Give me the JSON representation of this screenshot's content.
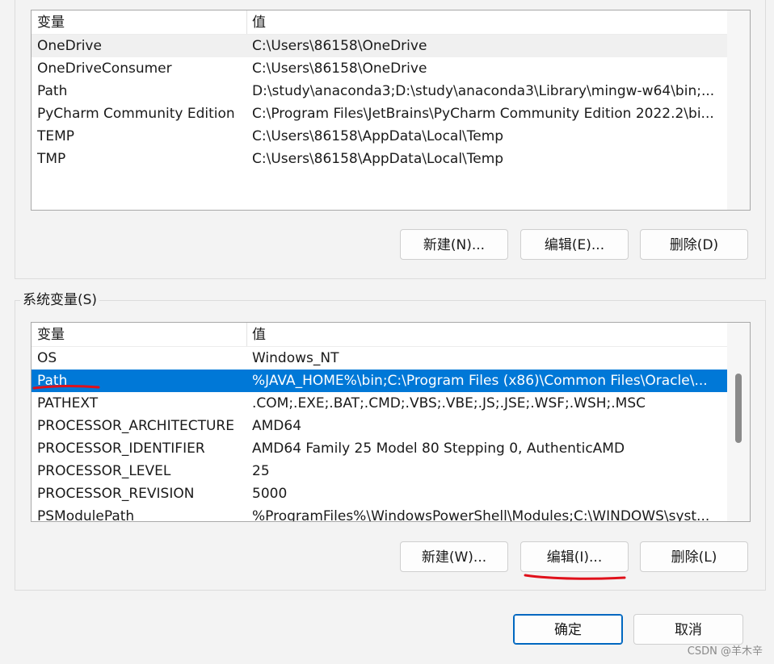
{
  "user_vars": {
    "headers": {
      "variable": "变量",
      "value": "值"
    },
    "rows": [
      {
        "name": "OneDrive",
        "value": "C:\\Users\\86158\\OneDrive"
      },
      {
        "name": "OneDriveConsumer",
        "value": "C:\\Users\\86158\\OneDrive"
      },
      {
        "name": "Path",
        "value": "D:\\study\\anaconda3;D:\\study\\anaconda3\\Library\\mingw-w64\\bin;..."
      },
      {
        "name": "PyCharm Community Edition",
        "value": "C:\\Program Files\\JetBrains\\PyCharm Community Edition 2022.2\\bi..."
      },
      {
        "name": "TEMP",
        "value": "C:\\Users\\86158\\AppData\\Local\\Temp"
      },
      {
        "name": "TMP",
        "value": "C:\\Users\\86158\\AppData\\Local\\Temp"
      }
    ],
    "hover_row": 0,
    "buttons": {
      "new": "新建(N)...",
      "edit": "编辑(E)...",
      "delete": "删除(D)"
    }
  },
  "system_vars": {
    "group_title": "系统变量(S)",
    "headers": {
      "variable": "变量",
      "value": "值"
    },
    "rows": [
      {
        "name": "OS",
        "value": "Windows_NT"
      },
      {
        "name": "Path",
        "value": "%JAVA_HOME%\\bin;C:\\Program Files (x86)\\Common Files\\Oracle\\..."
      },
      {
        "name": "PATHEXT",
        "value": ".COM;.EXE;.BAT;.CMD;.VBS;.VBE;.JS;.JSE;.WSF;.WSH;.MSC"
      },
      {
        "name": "PROCESSOR_ARCHITECTURE",
        "value": "AMD64"
      },
      {
        "name": "PROCESSOR_IDENTIFIER",
        "value": "AMD64 Family 25 Model 80 Stepping 0, AuthenticAMD"
      },
      {
        "name": "PROCESSOR_LEVEL",
        "value": "25"
      },
      {
        "name": "PROCESSOR_REVISION",
        "value": "5000"
      },
      {
        "name": "PSModulePath",
        "value": "%ProgramFiles%\\WindowsPowerShell\\Modules;C:\\WINDOWS\\syst..."
      }
    ],
    "selected_row": 1,
    "buttons": {
      "new": "新建(W)...",
      "edit": "编辑(I)...",
      "delete": "删除(L)"
    }
  },
  "dialog_buttons": {
    "ok": "确定",
    "cancel": "取消"
  },
  "colors": {
    "selection": "#0078d7",
    "annotation": "#e0101a"
  },
  "watermark": "CSDN @羊木辛"
}
